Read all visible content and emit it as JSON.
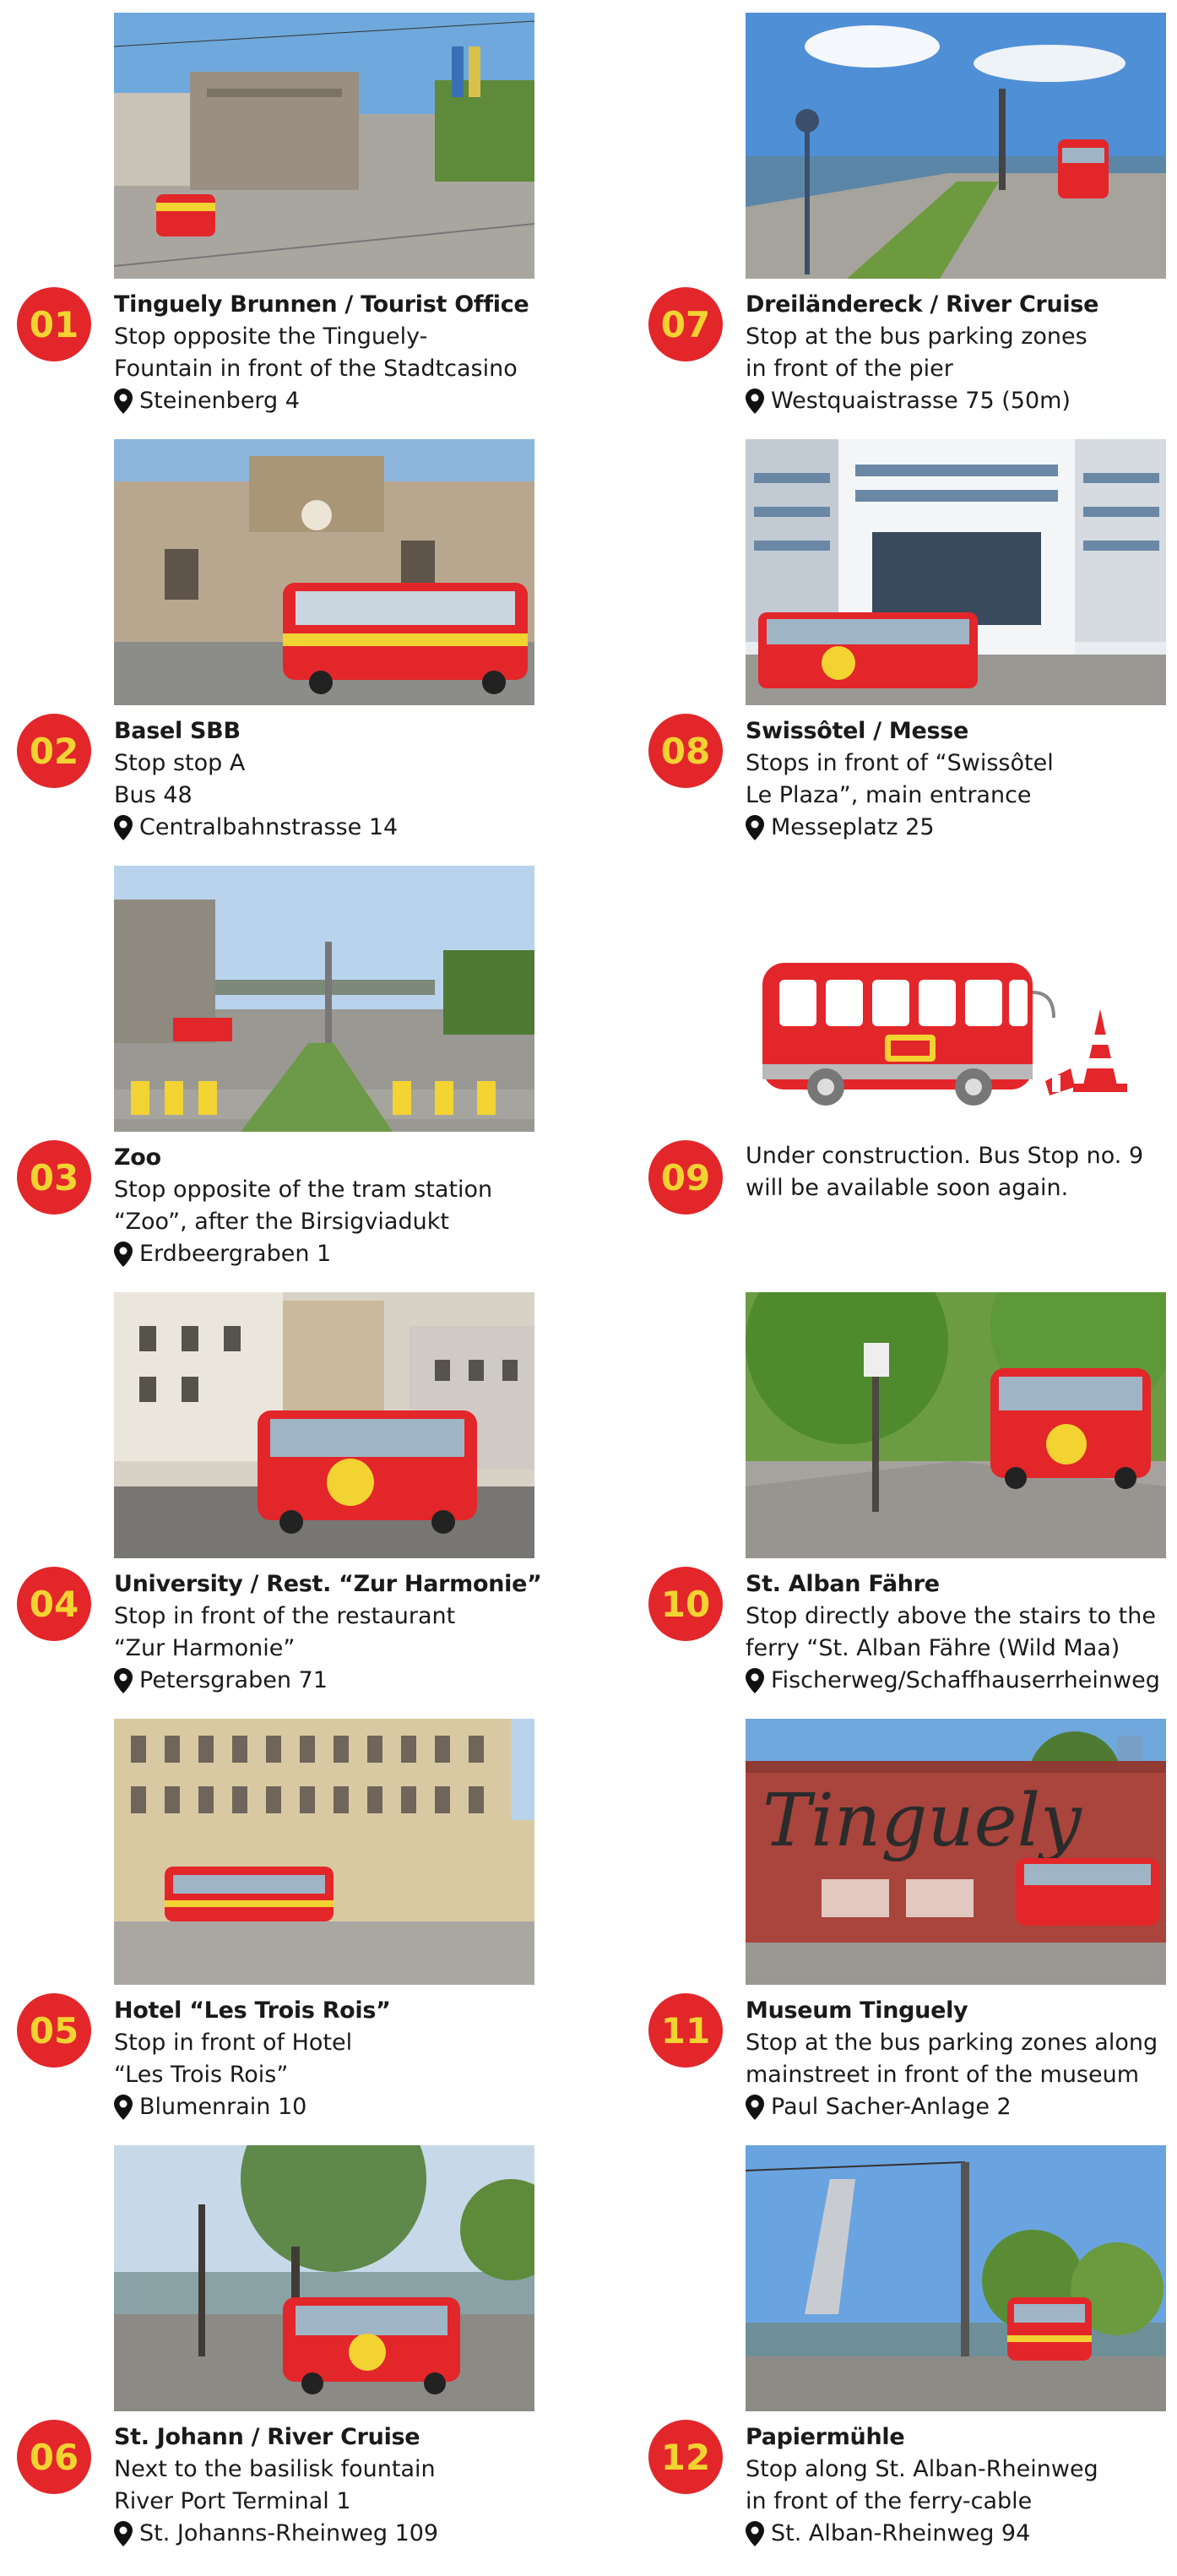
{
  "stops": [
    {
      "number": "01",
      "title": "Tinguely Brunnen / Tourist Office",
      "lines": [
        "Stop opposite the Tinguely-",
        "Fountain in front of the Stadtcasino"
      ],
      "address": "Steinenberg 4"
    },
    {
      "number": "02",
      "title": "Basel SBB",
      "lines": [
        "Stop stop A",
        "Bus 48"
      ],
      "address": "Centralbahnstrasse 14"
    },
    {
      "number": "03",
      "title": "Zoo",
      "lines": [
        "Stop opposite of the tram station",
        "“Zoo”, after the Birsigviadukt"
      ],
      "address": "Erdbeergraben 1"
    },
    {
      "number": "04",
      "title": "University / Rest. “Zur Harmonie”",
      "lines": [
        "Stop in front of the restaurant",
        "“Zur Harmonie”"
      ],
      "address": "Petersgraben 71"
    },
    {
      "number": "05",
      "title": "Hotel “Les Trois Rois”",
      "lines": [
        "Stop in front of Hotel",
        "“Les Trois Rois”"
      ],
      "address": "Blumenrain 10"
    },
    {
      "number": "06",
      "title": "St. Johann / River Cruise",
      "lines": [
        "Next to the basilisk fountain",
        "River Port Terminal 1"
      ],
      "address": "St. Johanns-Rheinweg 109"
    },
    {
      "number": "07",
      "title": "Dreiländereck / River Cruise",
      "lines": [
        "Stop at the bus parking zones",
        "in front of the pier"
      ],
      "address": "Westquaistrasse 75 (50m)"
    },
    {
      "number": "08",
      "title": "Swissôtel / Messe",
      "lines": [
        "Stops in front of “Swissôtel",
        "Le Plaza”, main entrance"
      ],
      "address": "Messeplatz 25"
    },
    {
      "number": "09",
      "title": "",
      "lines": [
        "Under construction. Bus Stop no. 9",
        "will be available soon again."
      ],
      "address": ""
    },
    {
      "number": "10",
      "title": "St. Alban Fähre",
      "lines": [
        "Stop directly above the stairs to the",
        "ferry “St. Alban Fähre (Wild Maa)"
      ],
      "address": "Fischerweg/Schaffhauserrheinweg"
    },
    {
      "number": "11",
      "title": "Museum Tinguely",
      "lines": [
        "Stop at the bus parking zones along",
        "mainstreet in front of the museum"
      ],
      "address": "Paul Sacher-Anlage 2"
    },
    {
      "number": "12",
      "title": "Papiermühle",
      "lines": [
        "Stop along St. Alban-Rheinweg",
        "in front of the ferry-cable"
      ],
      "address": "St. Alban-Rheinweg 94"
    }
  ],
  "photo_sign_text": "Tinguely",
  "colors": {
    "badge_bg": "#e3262a",
    "badge_text": "#f2d332",
    "bus_red": "#e3262a",
    "bus_yellow": "#f2d332"
  }
}
